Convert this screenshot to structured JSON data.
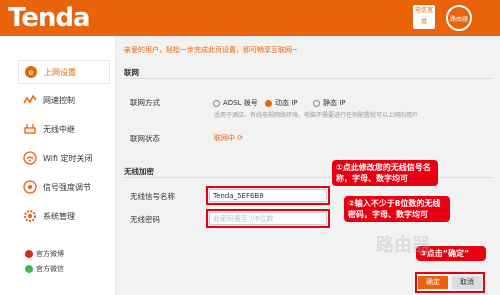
{
  "header": {
    "logo": "Tenda",
    "top_button": "电信宽带",
    "badge_text": "路由器"
  },
  "sidebar": {
    "items": [
      {
        "label": "上网设置",
        "icon": "internet-icon",
        "active": true
      },
      {
        "label": "网速控制",
        "icon": "speed-icon",
        "active": false
      },
      {
        "label": "无线中继",
        "icon": "relay-icon",
        "active": false
      },
      {
        "label": "Wifi 定时关闭",
        "icon": "wifi-icon",
        "active": false
      },
      {
        "label": "信号强度调节",
        "icon": "signal-icon",
        "active": false
      },
      {
        "label": "系统管理",
        "icon": "gear-icon",
        "active": false
      }
    ],
    "footer": [
      {
        "label": "官方微博",
        "icon": "weibo-icon"
      },
      {
        "label": "官方微信",
        "icon": "wechat-icon"
      }
    ]
  },
  "content": {
    "greeting": "亲爱的用户，轻松一步完成此页设置，即可畅享互联网~",
    "network_section": {
      "title": "联网",
      "method_label": "联网方式",
      "options": [
        {
          "label": "ADSL 拨号",
          "selected": false
        },
        {
          "label": "动态 IP",
          "selected": true
        },
        {
          "label": "静态 IP",
          "selected": false
        }
      ],
      "hint": "适用于酒店、有线电视网络环境、电脑不需要进行任何配置就可以上网的用户",
      "status_label": "联网状态",
      "status_value": "联网中"
    },
    "wireless_section": {
      "title": "无线加密",
      "ssid_label": "无线信号名称",
      "ssid_value": "Tenda_5EF6B8",
      "password_label": "无线密码",
      "password_placeholder": "此密码需至少8位数"
    },
    "callouts": {
      "one": "①点此修改您的无线信号名称，字母、数字均可",
      "two": "②输入不少于8位数的无线密码，字母、数字均可",
      "three": "③点击“确定”"
    },
    "buttons": {
      "ok": "确定",
      "cancel": "取消"
    },
    "watermark": "路由器"
  },
  "colors": {
    "brand": "#e8630a",
    "highlight": "#e60012"
  }
}
